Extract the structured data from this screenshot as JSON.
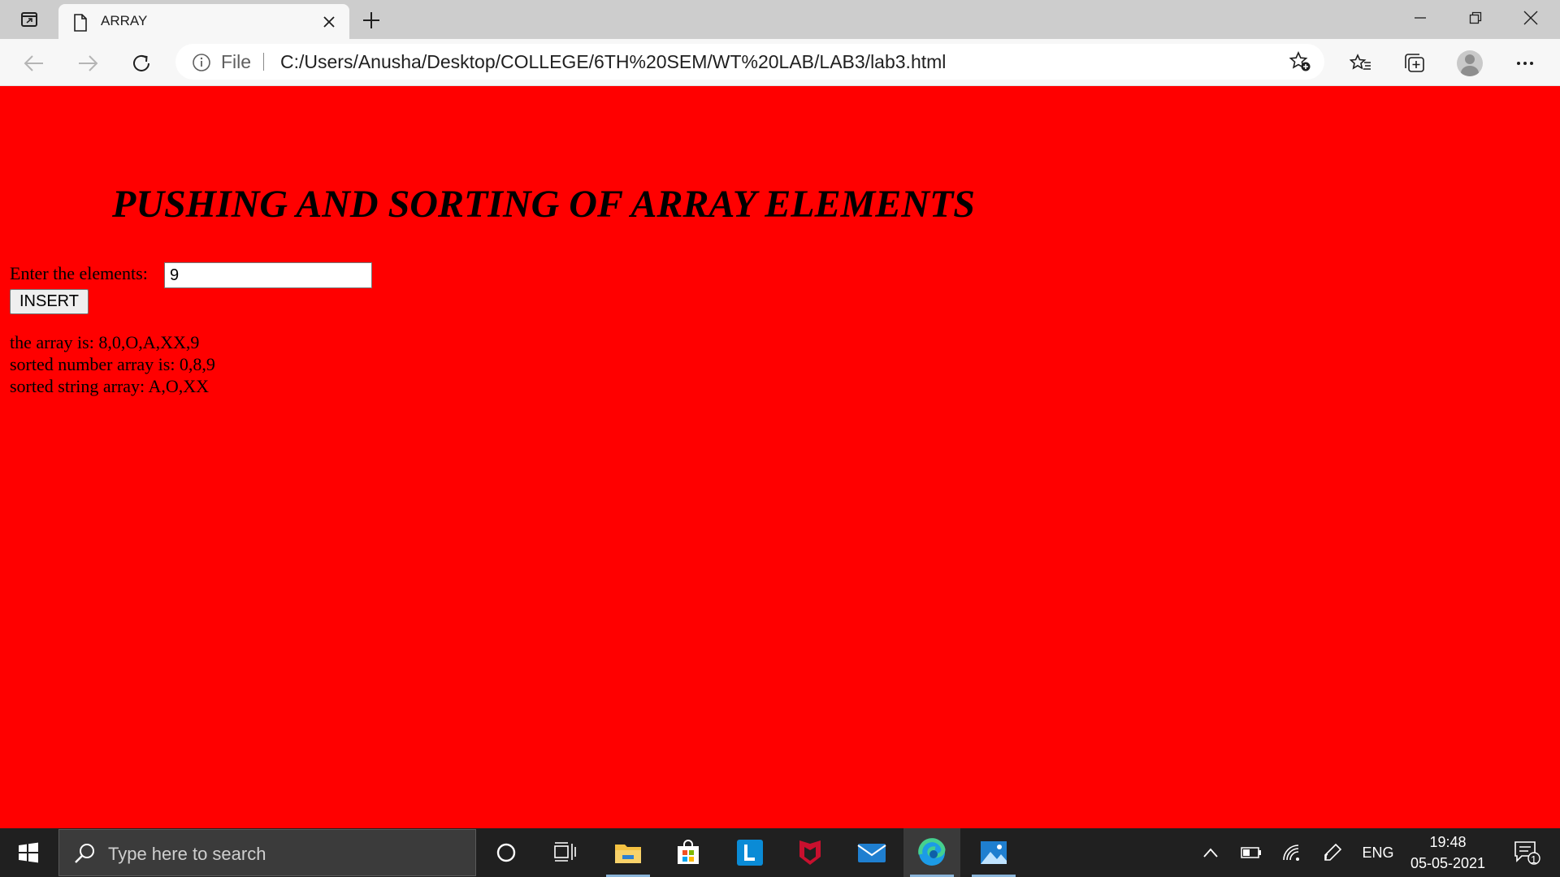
{
  "browser": {
    "tab_title": "ARRAY",
    "address": {
      "scheme_label": "File",
      "url": "C:/Users/Anusha/Desktop/COLLEGE/6TH%20SEM/WT%20LAB/LAB3/lab3.html"
    }
  },
  "page": {
    "background_color": "#ff0000",
    "heading": "PUSHING AND SORTING OF ARRAY ELEMENTS",
    "input_label": "Enter the elements:",
    "input_value": "9",
    "insert_button": "INSERT",
    "output": {
      "array_line": "the array is: 8,0,O,A,XX,9",
      "sorted_numbers_line": "sorted number array is: 0,8,9",
      "sorted_strings_line": "sorted string array: A,O,XX"
    }
  },
  "taskbar": {
    "search_placeholder": "Type here to search",
    "language": "ENG",
    "time": "19:48",
    "date": "05-05-2021",
    "notification_count": "1"
  }
}
